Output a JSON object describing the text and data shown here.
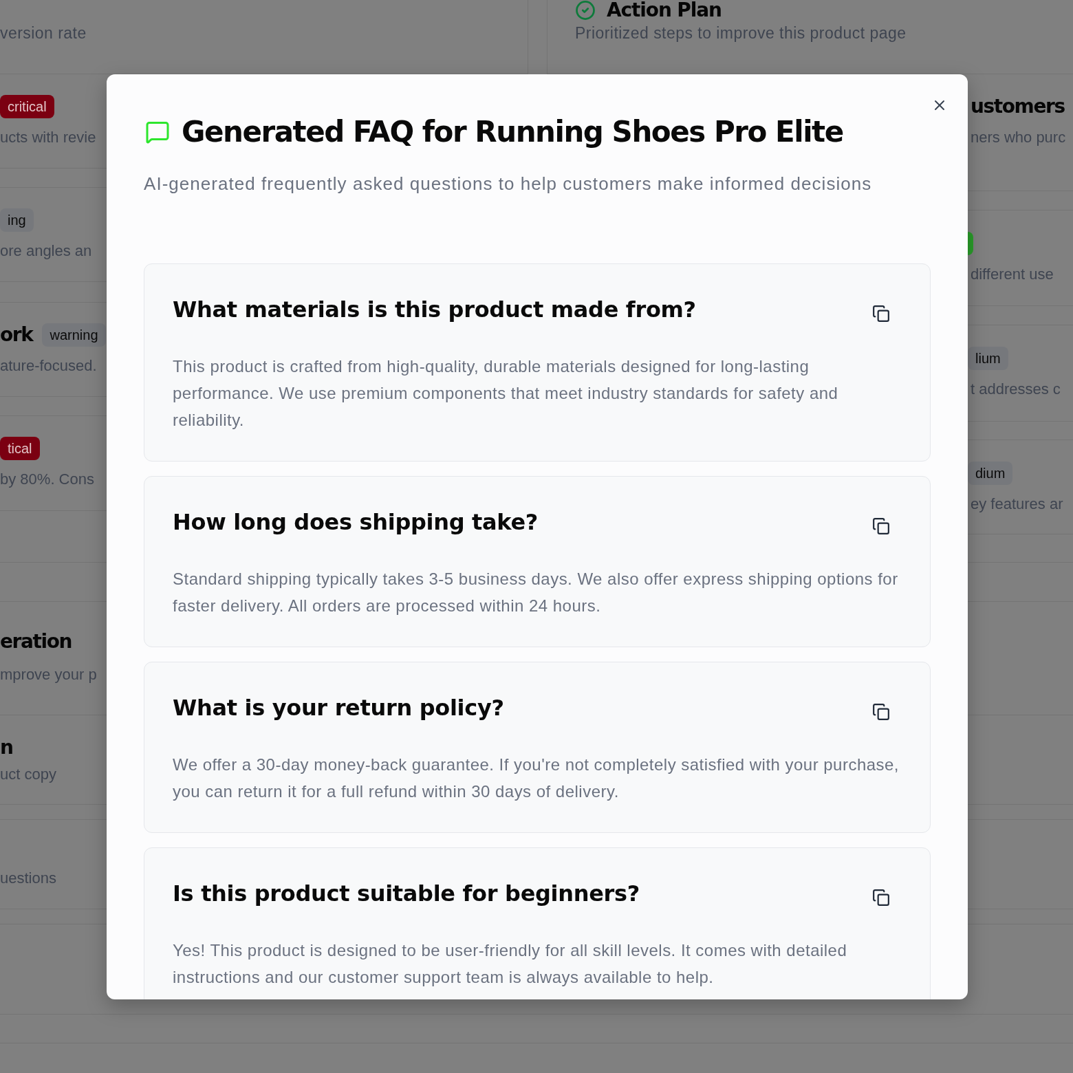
{
  "background_page": {
    "left_column": {
      "description": "version rate",
      "issues": [
        {
          "badge": {
            "text": "critical",
            "color": "#7b0011"
          },
          "description": "ucts with revie"
        },
        {
          "badge": {
            "text": "ing",
            "color": "#76787c"
          },
          "description": "ore angles an"
        },
        {
          "title": "ork",
          "badge": {
            "text": "warning",
            "color": "#76787c"
          },
          "description": "ature-focused."
        },
        {
          "badge": {
            "text": "tical",
            "color": "#7b0011"
          },
          "description": "by 80%. Cons"
        }
      ],
      "sections": [
        {
          "title": "eration",
          "description": "mprove your p"
        },
        {
          "title": "n",
          "description": "uct copy"
        },
        {
          "description": "uestions"
        }
      ]
    },
    "right_column": {
      "title": "Action Plan",
      "description": "Prioritized steps to improve this product page",
      "steps": [
        {
          "title": "ustomers",
          "description": "ners who purc"
        },
        {
          "badge": {
            "color": "#2a9d2a"
          },
          "description": "different use"
        },
        {
          "badge": {
            "text": "lium",
            "color": "#76787c"
          },
          "description": "t addresses c"
        },
        {
          "badge": {
            "text": "dium",
            "color": "#76787c"
          },
          "description": "ey features ar"
        }
      ]
    }
  },
  "dialog": {
    "title": "Generated FAQ for Running Shoes Pro Elite",
    "description": "AI-generated frequently asked questions to help customers make informed decisions",
    "faqs": [
      {
        "question": "What materials is this product made from?",
        "answer": "This product is crafted from high-quality, durable materials designed for long-lasting performance. We use premium components that meet industry standards for safety and reliability."
      },
      {
        "question": "How long does shipping take?",
        "answer": "Standard shipping typically takes 3-5 business days. We also offer express shipping options for faster delivery. All orders are processed within 24 hours."
      },
      {
        "question": "What is your return policy?",
        "answer": "We offer a 30-day money-back guarantee. If you're not completely satisfied with your purchase, you can return it for a full refund within 30 days of delivery."
      },
      {
        "question": "Is this product suitable for beginners?",
        "answer": "Yes! This product is designed to be user-friendly for all skill levels. It comes with detailed instructions and our customer support team is always available to help."
      }
    ]
  }
}
